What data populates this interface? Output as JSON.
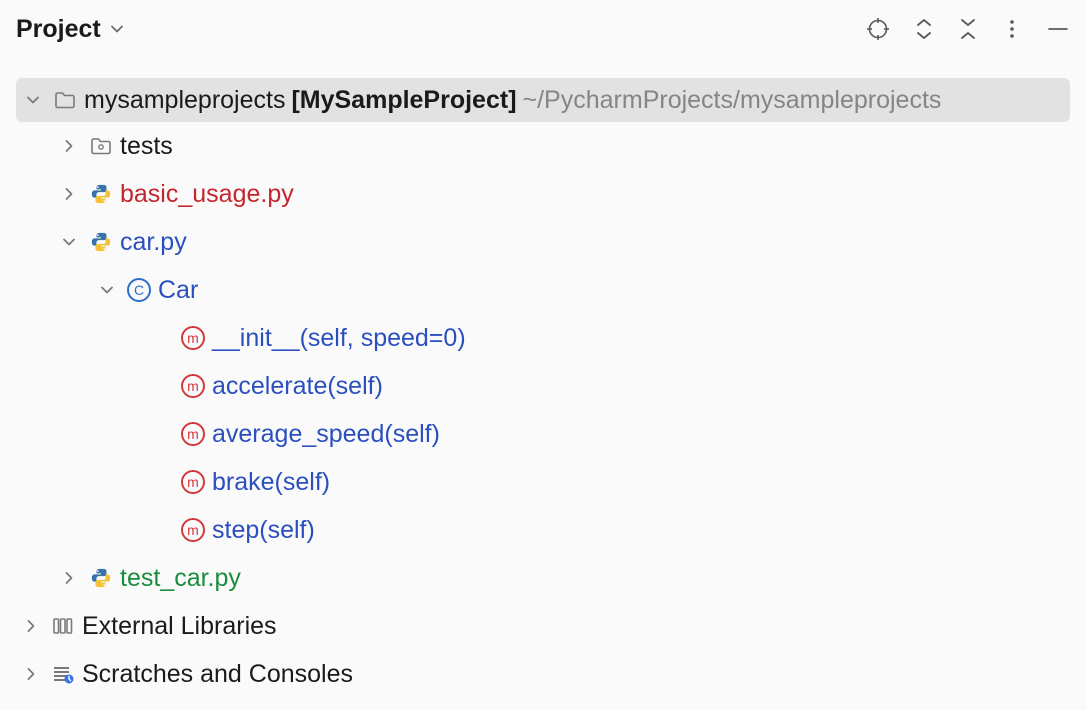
{
  "header": {
    "title": "Project"
  },
  "root": {
    "name": "mysampleprojects",
    "context": "[MySampleProject]",
    "path": "~/PycharmProjects/mysampleprojects"
  },
  "items": {
    "tests": "tests",
    "basic_usage": "basic_usage.py",
    "car_py": "car.py",
    "class_car": "Car",
    "m_init": "__init__(self, speed=0)",
    "m_accelerate": "accelerate(self)",
    "m_avg": "average_speed(self)",
    "m_brake": "brake(self)",
    "m_step": "step(self)",
    "test_car": "test_car.py",
    "extlib": "External Libraries",
    "scratches": "Scratches and Consoles"
  }
}
